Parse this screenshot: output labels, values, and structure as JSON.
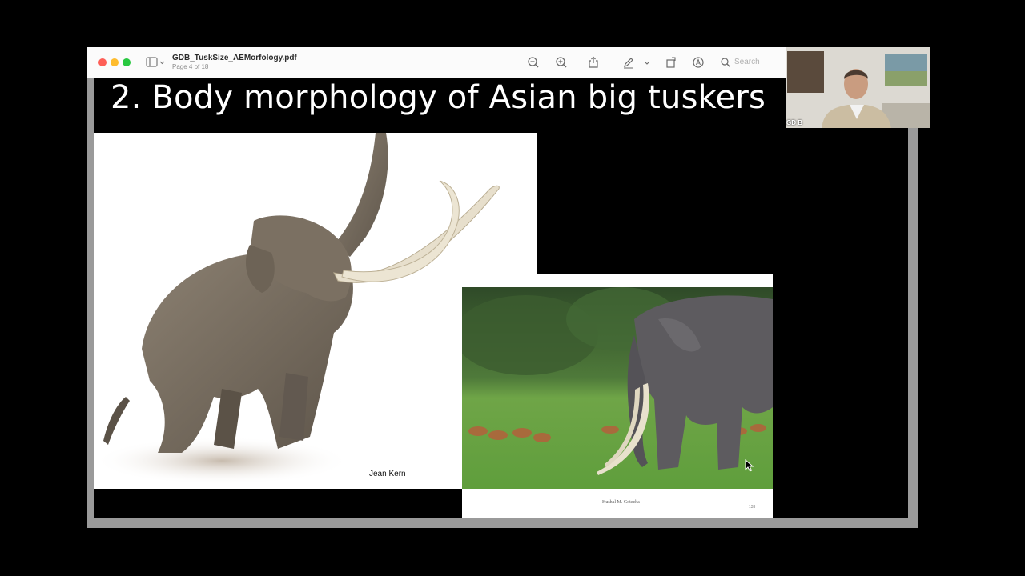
{
  "window": {
    "doc_title": "GDB_TuskSize_AEMorfology.pdf",
    "page_indicator": "Page 4 of 18",
    "search_placeholder": "Search"
  },
  "toolbar": {
    "icons": [
      "zoom-out-icon",
      "zoom-in-icon",
      "share-icon",
      "markup-pen-icon",
      "chevron-down-icon",
      "rotate-icon",
      "annotate-icon",
      "search-icon"
    ]
  },
  "slide": {
    "title": "2. Body morphology of Asian big tuskers",
    "left_credit": "Jean Kern",
    "right_credit": "Kushal M. Gotecha",
    "right_page_number": "133"
  },
  "video": {
    "participant_label": "GD B"
  },
  "colors": {
    "close": "#fe5f57",
    "minimize": "#febc2e",
    "zoom": "#28c840",
    "page_background": "#000000"
  }
}
